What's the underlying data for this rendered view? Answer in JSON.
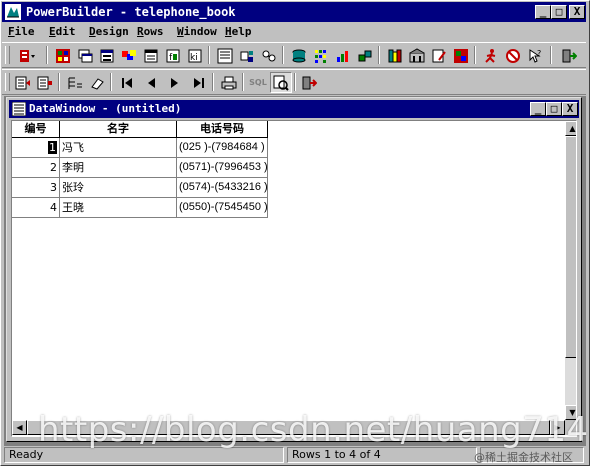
{
  "window": {
    "title": "PowerBuilder - telephone_book",
    "minimize": "_",
    "maximize": "□",
    "close": "X"
  },
  "menu": [
    {
      "label": "File",
      "key": "F",
      "rest": "ile"
    },
    {
      "label": "Edit",
      "key": "E",
      "rest": "dit"
    },
    {
      "label": "Design",
      "key": "D",
      "rest": "esign"
    },
    {
      "label": "Rows",
      "key": "R",
      "rest": "ows"
    },
    {
      "label": "Window",
      "key": "W",
      "rest": "indow"
    },
    {
      "label": "Help",
      "key": "H",
      "rest": "elp"
    }
  ],
  "toolbar2": {
    "sql_label": "SQL"
  },
  "child_window": {
    "title": "DataWindow - (untitled)",
    "minimize": "_",
    "maximize": "□",
    "close": "X"
  },
  "table": {
    "headers": [
      "编号",
      "名字",
      "电话号码"
    ],
    "rows": [
      {
        "id": "1",
        "name": "冯飞",
        "phone": "(025 )-(7984684 )"
      },
      {
        "id": "2",
        "name": "李明",
        "phone": "(0571)-(7996453 )"
      },
      {
        "id": "3",
        "name": "张玲",
        "phone": "(0574)-(5433216 )"
      },
      {
        "id": "4",
        "name": "王晓",
        "phone": "(0550)-(7545450 )"
      }
    ]
  },
  "status": {
    "left": "Ready",
    "rows": "Rows 1 to 4 of 4"
  },
  "watermark": {
    "url": "https://blog.csdn.net/huang714",
    "credit": "@稀土掘金技术社区"
  }
}
